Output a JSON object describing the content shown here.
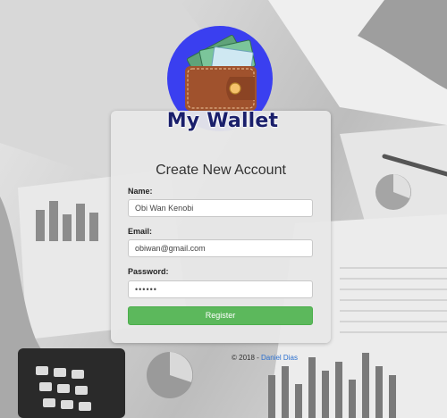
{
  "app": {
    "logo_text": "My Wallet",
    "logo_icon": "wallet-icon"
  },
  "form": {
    "title": "Create New Account",
    "name_label": "Name:",
    "name_value": "Obi Wan Kenobi",
    "email_label": "Email:",
    "email_value": "obiwan@gmail.com",
    "password_label": "Password:",
    "password_value": "••••••",
    "register_label": "Register"
  },
  "footer": {
    "copyright": "© 2018 - ",
    "author_link": "Daniel Dias"
  },
  "colors": {
    "logo_circle": "#3a3ff0",
    "button_green": "#5cb85c",
    "link_blue": "#2a6fcf"
  }
}
